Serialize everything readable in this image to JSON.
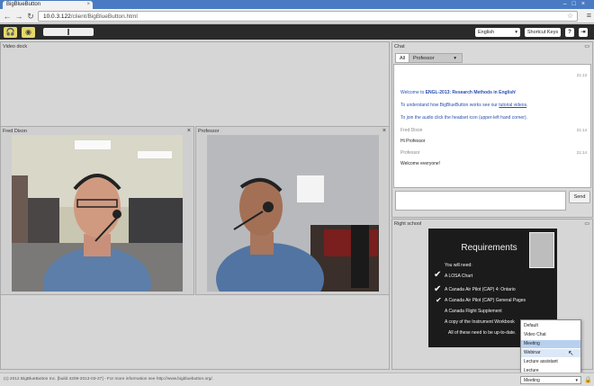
{
  "browser": {
    "tab_title": "BigBlueButton",
    "address_host": "10.0.3.122",
    "address_path": "/client/BigBlueButton.html"
  },
  "toolbar": {
    "language": "English",
    "shortcut_keys": "Shortcut Keys",
    "help": "?"
  },
  "video_dock": {
    "title": "Video dock",
    "windows": [
      {
        "name": "Fred Dixon"
      },
      {
        "name": "Professor"
      }
    ]
  },
  "chat": {
    "title": "Chat",
    "tabs": [
      "All",
      "Professor"
    ],
    "welcome_time": "21:13",
    "welcome_line1_prefix": "Welcome to ",
    "welcome_line1_bold": "ENGL-2013: Research Methods in English",
    "welcome_line1_suffix": "!",
    "welcome_line2_prefix": "To understand how BigBlueButton works see our ",
    "welcome_line2_link": "tutorial videos",
    "welcome_line2_suffix": ".",
    "welcome_line3": "To join the audio click the headset icon (upper-left hand corner).",
    "messages": [
      {
        "sender": "Fred Dixon",
        "time": "21:14",
        "text": "Hi Professor"
      },
      {
        "sender": "Professor",
        "time": "21:14",
        "text": "Welcome everyone!"
      }
    ],
    "send_label": "Send"
  },
  "presentation": {
    "title": "Right school",
    "slide": {
      "heading": "Requirements",
      "lines": [
        "You will need:",
        "A LOSA Chart",
        "A Canada Air Pilot (CAP) 4: Ontario",
        "A Canada Air Pilot (CAP) General Pages",
        "A Canada Flight Supplement",
        "A copy of the Instrument Workbook",
        "All of these need to be up-to-date."
      ]
    }
  },
  "layout_menu": {
    "options": [
      "Default",
      "Video Chat",
      "Meeting",
      "Webinar",
      "Lecture assistant",
      "Lecture"
    ],
    "selected": "Meeting",
    "hovered": "Webinar"
  },
  "status": {
    "copyright": "(c) 2012 BigBlueButton Inc. [build 4209-2013-03-27] - For more information see http://www.bigbluebutton.org/."
  },
  "colors": {
    "toolbar_bg": "#2a2a2a",
    "tab_bar": "#4a7bc2",
    "link_blue": "#2a4fb0",
    "menu_selected": "#b8d0ef"
  }
}
